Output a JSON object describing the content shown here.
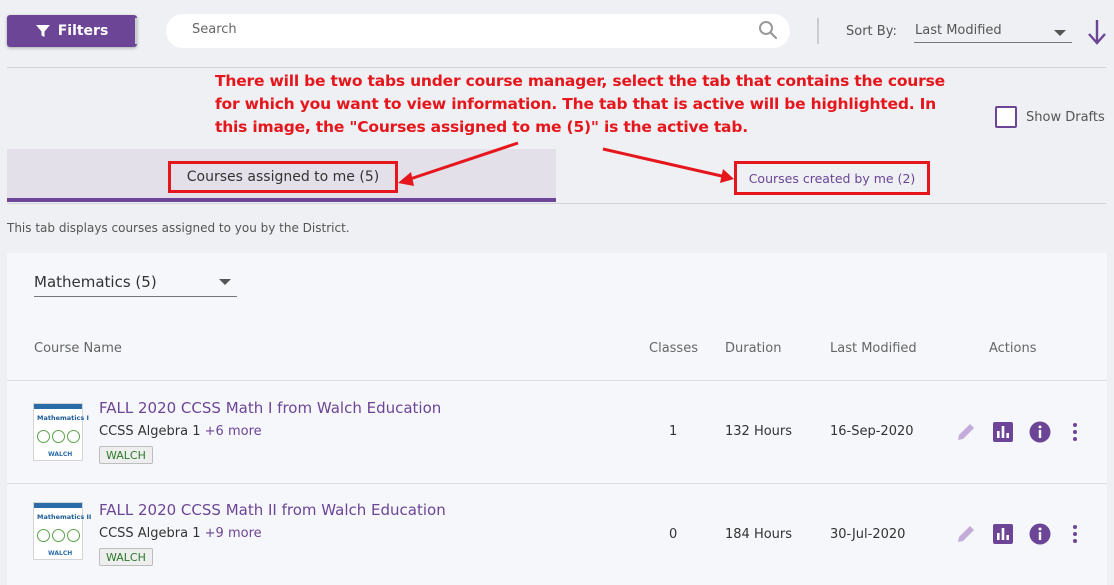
{
  "toolbar": {
    "filters_label": "Filters",
    "search_placeholder": "Search",
    "sort_label": "Sort By:",
    "sort_value": "Last Modified"
  },
  "annotation": {
    "text": "There will be two tabs under course manager, select the tab that contains the course for which you want to view information. The tab that is active will be highlighted. In this image, the \"Courses assigned to me (5)\" is the active tab."
  },
  "show_drafts_label": "Show Drafts",
  "tabs": [
    {
      "label": "Courses assigned to me (5)",
      "active": true
    },
    {
      "label": "Courses created by me (2)",
      "active": false
    }
  ],
  "tab_description": "This tab displays courses assigned to you by the District.",
  "subject_filter": {
    "value": "Mathematics (5)"
  },
  "table": {
    "headers": {
      "name": "Course Name",
      "classes": "Classes",
      "duration": "Duration",
      "modified": "Last Modified",
      "actions": "Actions"
    },
    "rows": [
      {
        "title": "FALL 2020 CCSS Math I from Walch Education",
        "subject": "CCSS Algebra 1",
        "more": "+6 more",
        "tag": "WALCH",
        "classes": "1",
        "duration": "132 Hours",
        "modified": "16-Sep-2020",
        "thumb_title": "Mathematics I",
        "thumb_logo": "WALCH"
      },
      {
        "title": "FALL 2020 CCSS Math II from Walch Education",
        "subject": "CCSS Algebra 1",
        "more": "+9 more",
        "tag": "WALCH",
        "classes": "0",
        "duration": "184 Hours",
        "modified": "30-Jul-2020",
        "thumb_title": "Mathematics II",
        "thumb_logo": "WALCH"
      }
    ]
  },
  "colors": {
    "accent": "#6c4596",
    "annotation": "#e5161c",
    "tag_text": "#2a7a2a"
  }
}
